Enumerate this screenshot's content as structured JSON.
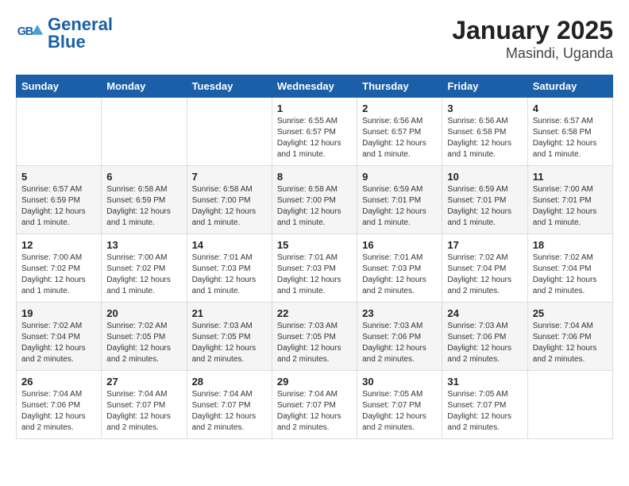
{
  "logo": {
    "name": "GeneralBlue",
    "line1": "General",
    "line2": "Blue"
  },
  "title": "January 2025",
  "subtitle": "Masindi, Uganda",
  "weekdays": [
    "Sunday",
    "Monday",
    "Tuesday",
    "Wednesday",
    "Thursday",
    "Friday",
    "Saturday"
  ],
  "weeks": [
    [
      {
        "day": "",
        "info": ""
      },
      {
        "day": "",
        "info": ""
      },
      {
        "day": "",
        "info": ""
      },
      {
        "day": "1",
        "info": "Sunrise: 6:55 AM\nSunset: 6:57 PM\nDaylight: 12 hours\nand 1 minute."
      },
      {
        "day": "2",
        "info": "Sunrise: 6:56 AM\nSunset: 6:57 PM\nDaylight: 12 hours\nand 1 minute."
      },
      {
        "day": "3",
        "info": "Sunrise: 6:56 AM\nSunset: 6:58 PM\nDaylight: 12 hours\nand 1 minute."
      },
      {
        "day": "4",
        "info": "Sunrise: 6:57 AM\nSunset: 6:58 PM\nDaylight: 12 hours\nand 1 minute."
      }
    ],
    [
      {
        "day": "5",
        "info": "Sunrise: 6:57 AM\nSunset: 6:59 PM\nDaylight: 12 hours\nand 1 minute."
      },
      {
        "day": "6",
        "info": "Sunrise: 6:58 AM\nSunset: 6:59 PM\nDaylight: 12 hours\nand 1 minute."
      },
      {
        "day": "7",
        "info": "Sunrise: 6:58 AM\nSunset: 7:00 PM\nDaylight: 12 hours\nand 1 minute."
      },
      {
        "day": "8",
        "info": "Sunrise: 6:58 AM\nSunset: 7:00 PM\nDaylight: 12 hours\nand 1 minute."
      },
      {
        "day": "9",
        "info": "Sunrise: 6:59 AM\nSunset: 7:01 PM\nDaylight: 12 hours\nand 1 minute."
      },
      {
        "day": "10",
        "info": "Sunrise: 6:59 AM\nSunset: 7:01 PM\nDaylight: 12 hours\nand 1 minute."
      },
      {
        "day": "11",
        "info": "Sunrise: 7:00 AM\nSunset: 7:01 PM\nDaylight: 12 hours\nand 1 minute."
      }
    ],
    [
      {
        "day": "12",
        "info": "Sunrise: 7:00 AM\nSunset: 7:02 PM\nDaylight: 12 hours\nand 1 minute."
      },
      {
        "day": "13",
        "info": "Sunrise: 7:00 AM\nSunset: 7:02 PM\nDaylight: 12 hours\nand 1 minute."
      },
      {
        "day": "14",
        "info": "Sunrise: 7:01 AM\nSunset: 7:03 PM\nDaylight: 12 hours\nand 1 minute."
      },
      {
        "day": "15",
        "info": "Sunrise: 7:01 AM\nSunset: 7:03 PM\nDaylight: 12 hours\nand 1 minute."
      },
      {
        "day": "16",
        "info": "Sunrise: 7:01 AM\nSunset: 7:03 PM\nDaylight: 12 hours\nand 2 minutes."
      },
      {
        "day": "17",
        "info": "Sunrise: 7:02 AM\nSunset: 7:04 PM\nDaylight: 12 hours\nand 2 minutes."
      },
      {
        "day": "18",
        "info": "Sunrise: 7:02 AM\nSunset: 7:04 PM\nDaylight: 12 hours\nand 2 minutes."
      }
    ],
    [
      {
        "day": "19",
        "info": "Sunrise: 7:02 AM\nSunset: 7:04 PM\nDaylight: 12 hours\nand 2 minutes."
      },
      {
        "day": "20",
        "info": "Sunrise: 7:02 AM\nSunset: 7:05 PM\nDaylight: 12 hours\nand 2 minutes."
      },
      {
        "day": "21",
        "info": "Sunrise: 7:03 AM\nSunset: 7:05 PM\nDaylight: 12 hours\nand 2 minutes."
      },
      {
        "day": "22",
        "info": "Sunrise: 7:03 AM\nSunset: 7:05 PM\nDaylight: 12 hours\nand 2 minutes."
      },
      {
        "day": "23",
        "info": "Sunrise: 7:03 AM\nSunset: 7:06 PM\nDaylight: 12 hours\nand 2 minutes."
      },
      {
        "day": "24",
        "info": "Sunrise: 7:03 AM\nSunset: 7:06 PM\nDaylight: 12 hours\nand 2 minutes."
      },
      {
        "day": "25",
        "info": "Sunrise: 7:04 AM\nSunset: 7:06 PM\nDaylight: 12 hours\nand 2 minutes."
      }
    ],
    [
      {
        "day": "26",
        "info": "Sunrise: 7:04 AM\nSunset: 7:06 PM\nDaylight: 12 hours\nand 2 minutes."
      },
      {
        "day": "27",
        "info": "Sunrise: 7:04 AM\nSunset: 7:07 PM\nDaylight: 12 hours\nand 2 minutes."
      },
      {
        "day": "28",
        "info": "Sunrise: 7:04 AM\nSunset: 7:07 PM\nDaylight: 12 hours\nand 2 minutes."
      },
      {
        "day": "29",
        "info": "Sunrise: 7:04 AM\nSunset: 7:07 PM\nDaylight: 12 hours\nand 2 minutes."
      },
      {
        "day": "30",
        "info": "Sunrise: 7:05 AM\nSunset: 7:07 PM\nDaylight: 12 hours\nand 2 minutes."
      },
      {
        "day": "31",
        "info": "Sunrise: 7:05 AM\nSunset: 7:07 PM\nDaylight: 12 hours\nand 2 minutes."
      },
      {
        "day": "",
        "info": ""
      }
    ]
  ]
}
